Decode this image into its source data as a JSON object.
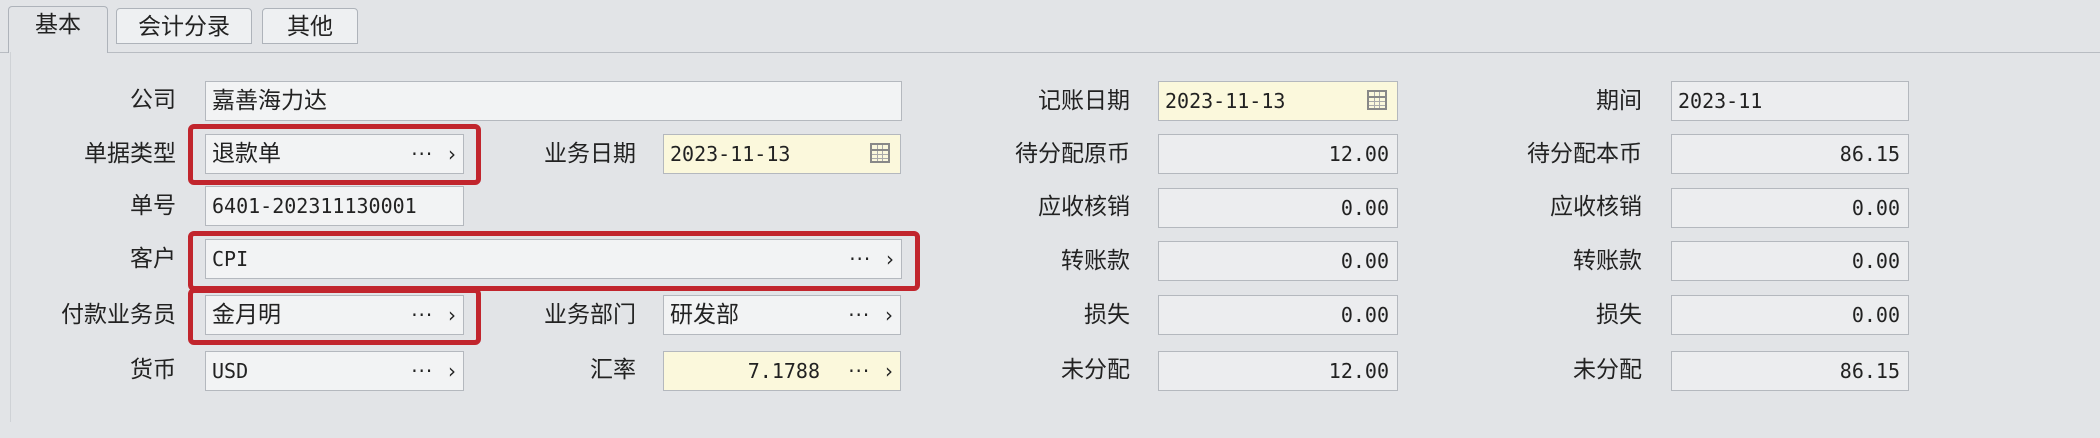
{
  "tabs": [
    "基本",
    "会计分录",
    "其他"
  ],
  "form": {
    "company": {
      "label": "公司",
      "value": "嘉善海力达"
    },
    "doc_type": {
      "label": "单据类型",
      "value": "退款单"
    },
    "biz_date": {
      "label": "业务日期",
      "value": "2023-11-13"
    },
    "doc_no": {
      "label": "单号",
      "value": "6401-202311130001"
    },
    "customer": {
      "label": "客户",
      "value": "CPI"
    },
    "payer": {
      "label": "付款业务员",
      "value": "金月明"
    },
    "dept": {
      "label": "业务部门",
      "value": "研发部"
    },
    "currency": {
      "label": "货币",
      "value": "USD"
    },
    "rate": {
      "label": "汇率",
      "value": "7.1788"
    },
    "post_date": {
      "label": "记账日期",
      "value": "2023-11-13"
    },
    "period": {
      "label": "期间",
      "value": "2023-11"
    },
    "mid_col": [
      {
        "label": "待分配原币",
        "value": "12.00"
      },
      {
        "label": "应收核销",
        "value": "0.00"
      },
      {
        "label": "转账款",
        "value": "0.00"
      },
      {
        "label": "损失",
        "value": "0.00"
      },
      {
        "label": "未分配",
        "value": "12.00"
      }
    ],
    "right_col": [
      {
        "label": "待分配本币",
        "value": "86.15"
      },
      {
        "label": "应收核销",
        "value": "0.00"
      },
      {
        "label": "转账款",
        "value": "0.00"
      },
      {
        "label": "损失",
        "value": "0.00"
      },
      {
        "label": "未分配",
        "value": "86.15"
      }
    ]
  },
  "icons": {
    "more": "···",
    "arrow": "›"
  },
  "colors": {
    "highlight": "#c1252d",
    "required_bg": "#fbf8dc"
  }
}
